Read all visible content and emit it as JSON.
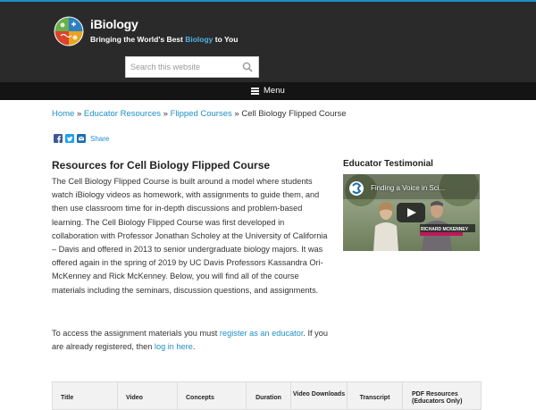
{
  "site": {
    "brand": "iBiology",
    "tagline_parts": [
      "Bringing the World's Best ",
      "Biology",
      " to You"
    ]
  },
  "search": {
    "placeholder": "Search this website",
    "icon": "magnifier-icon"
  },
  "nav": {
    "menu_label": "Menu",
    "icon": "hamburger-icon"
  },
  "breadcrumb": {
    "items": [
      "Home",
      "Educator Resources",
      "Flipped Courses"
    ],
    "separator": "»",
    "current": "Cell Biology Flipped Course"
  },
  "share": {
    "label": "Share",
    "icons": [
      "facebook-icon",
      "twitter-icon",
      "email-icon"
    ]
  },
  "main": {
    "title": "Resources for Cell Biology Flipped Course",
    "paragraph": "The Cell Biology Flipped Course is built around a model where students watch iBiology videos as homework, with assignments to guide them, and then use classroom time for in-depth discussions and problem-based learning. The Cell Biology Flipped Course was first developed in collaboration with Professor Jonathan Scholey at the University of California – Davis and offered in 2013 to senior undergraduate biology majors. It was offered again in the spring of 2019 by UC Davis Professors Kassandra Ori-McKenney and Rick McKenney. Below, you will find all of the course materials including the seminars, discussion questions, and assignments.",
    "access": {
      "prefix": "To access the assignment materials you must ",
      "link1": "register as an educator",
      "middle": ". If you are already registered, then ",
      "link2": "log in here",
      "suffix": "."
    }
  },
  "sidebar": {
    "title": "Educator Testimonial",
    "video": {
      "title": "Finding a Voice in Sci...",
      "caption": "RICHARD MCKENNEY",
      "play_icon": "play-icon"
    }
  },
  "table": {
    "headers": [
      "Title",
      "Video",
      "Concepts",
      "Duration",
      "Video Downloads",
      "Transcript",
      "PDF Resources (Educators Only)"
    ]
  },
  "colors": {
    "accent": "#1e8fc6",
    "header_bg": "#2a2a2a",
    "nav_bg": "#141414"
  }
}
